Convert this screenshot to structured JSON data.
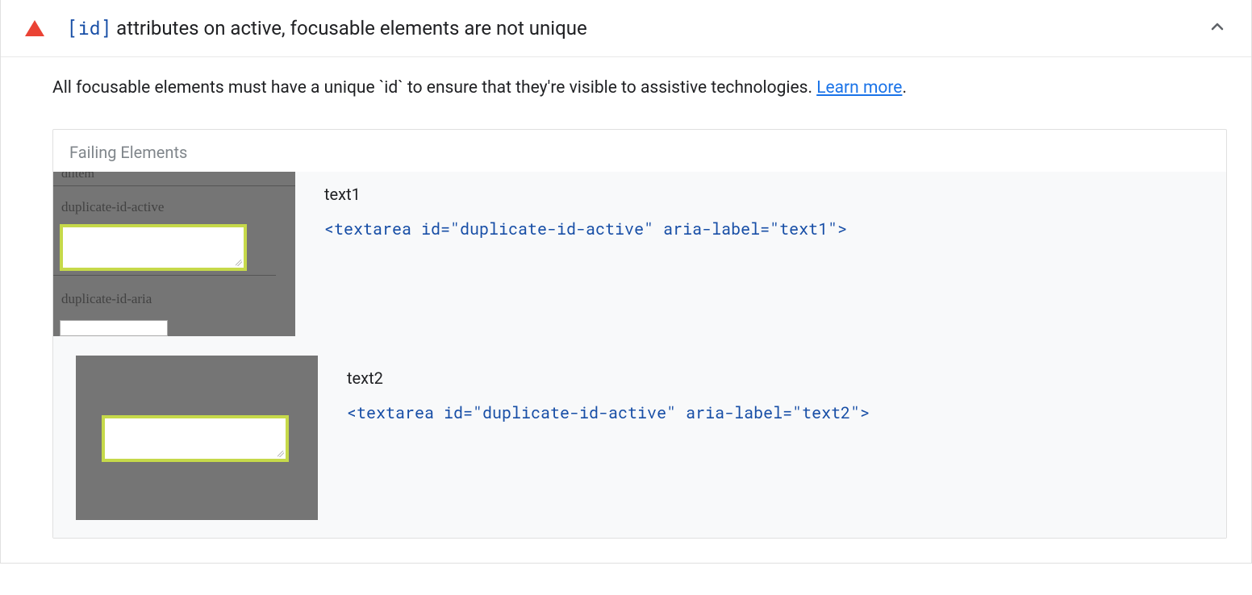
{
  "header": {
    "code_badge": "[id]",
    "title_suffix": " attributes on active, focusable elements are not unique"
  },
  "description": {
    "text": "All focusable elements must have a unique `id` to ensure that they're visible to assistive technologies. ",
    "learn_more_label": "Learn more",
    "period": "."
  },
  "failing_section": {
    "heading": "Failing Elements",
    "items": [
      {
        "label": "text1",
        "snippet": "<textarea id=\"duplicate-id-active\" aria-label=\"text1\">",
        "thumb_labels": {
          "partial": "dlitem",
          "top": "duplicate-id-active",
          "bottom": "duplicate-id-aria"
        }
      },
      {
        "label": "text2",
        "snippet": "<textarea id=\"duplicate-id-active\" aria-label=\"text2\">"
      }
    ]
  }
}
